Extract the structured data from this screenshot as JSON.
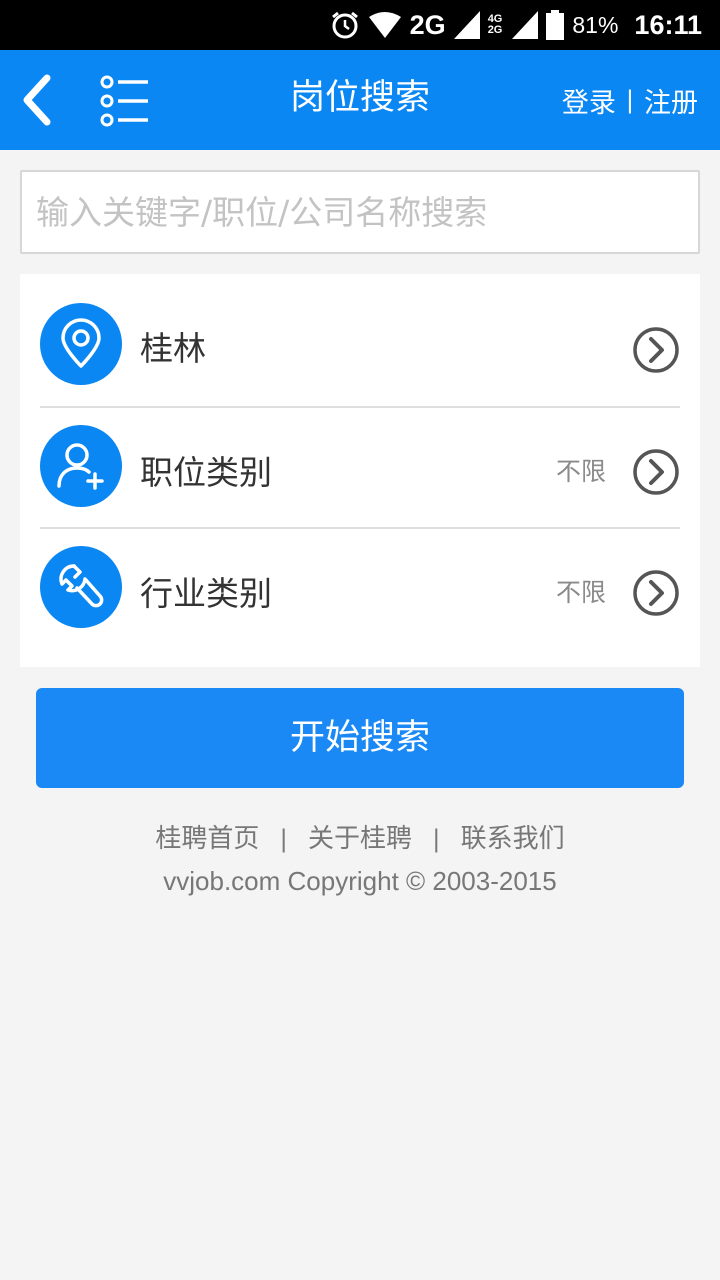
{
  "status_bar": {
    "network": "2G",
    "network_small_top": "4G",
    "network_small_bottom": "2G",
    "battery": "81%",
    "time": "16:11"
  },
  "nav": {
    "title": "岗位搜索",
    "login": "登录",
    "separator": "|",
    "register": "注册",
    "back_icon": "chevron-left-icon",
    "menu_icon": "list-icon"
  },
  "search": {
    "placeholder": "输入关键字/职位/公司名称搜索",
    "value": ""
  },
  "filters": [
    {
      "label": "桂林",
      "value": "",
      "icon": "location-pin-icon"
    },
    {
      "label": "职位类别",
      "value": "不限",
      "icon": "user-add-icon"
    },
    {
      "label": "行业类别",
      "value": "不限",
      "icon": "wrench-icon"
    }
  ],
  "search_button": "开始搜索",
  "footer": {
    "links": [
      "桂聘首页",
      "关于桂聘",
      "联系我们"
    ],
    "separator": "|",
    "copyright": "vvjob.com Copyright © 2003-2015"
  },
  "colors": {
    "primary": "#0b87f4",
    "button": "#1a88f5",
    "background": "#f4f4f4"
  }
}
